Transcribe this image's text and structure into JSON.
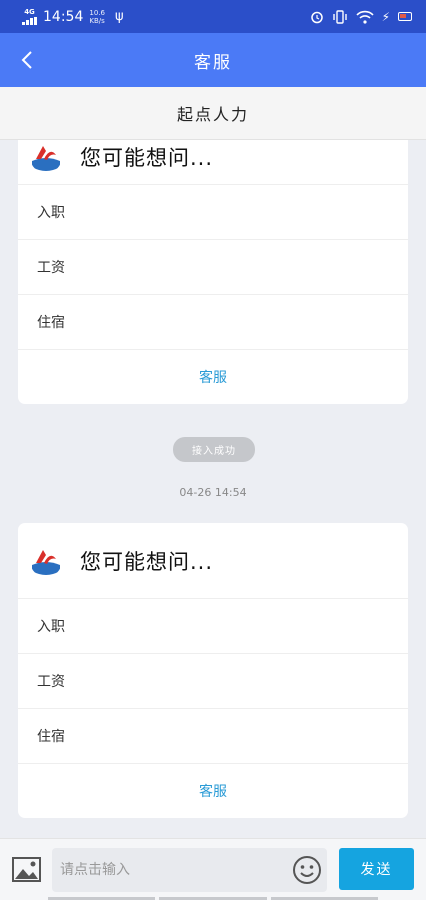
{
  "status_bar": {
    "network": "4G",
    "time": "14:54",
    "speed_value": "10.6",
    "speed_unit": "KB/s",
    "accent": "#2b4fc9"
  },
  "header": {
    "title": "客服",
    "back_icon": "chevron-left-icon",
    "color": "#4b7af6"
  },
  "subheader": {
    "title": "起点人力"
  },
  "cards": [
    {
      "heading": "您可能想问...",
      "items": [
        "入职",
        "工资",
        "住宿"
      ],
      "footer": "客服"
    },
    {
      "heading": "您可能想问...",
      "items": [
        "入职",
        "工资",
        "住宿"
      ],
      "footer": "客服"
    }
  ],
  "system_message": "接入成功",
  "timestamp": "04-26 14:54",
  "input": {
    "placeholder": "请点击输入",
    "value": ""
  },
  "send_label": "发送",
  "send_color": "#15a4e0"
}
